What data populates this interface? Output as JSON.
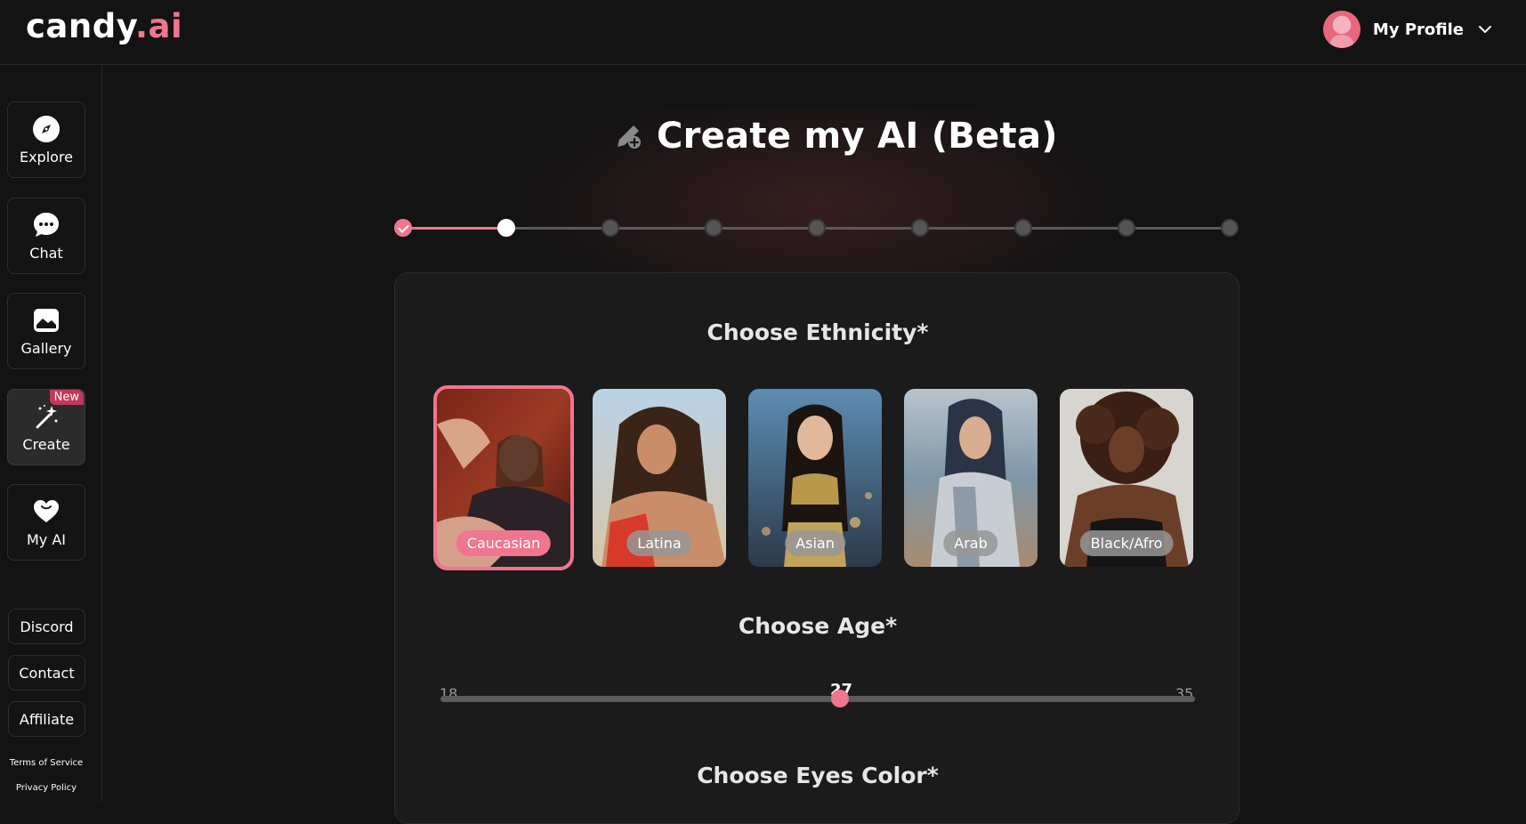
{
  "app": {
    "logo_main": "candy",
    "logo_suffix": ".ai",
    "accent": "#f0758e"
  },
  "header": {
    "profile_label": "My Profile",
    "profile_icon": "avatar",
    "dropdown_icon": "chevron-down-icon"
  },
  "sidebar": {
    "items": [
      {
        "label": "Explore",
        "icon": "compass-icon"
      },
      {
        "label": "Chat",
        "icon": "chat-bubble-icon"
      },
      {
        "label": "Gallery",
        "icon": "image-icon"
      },
      {
        "label": "Create",
        "icon": "magic-wand-icon",
        "badge": "New",
        "active": true
      },
      {
        "label": "My AI",
        "icon": "heart-icon"
      }
    ],
    "links": [
      "Discord",
      "Contact",
      "Affiliate"
    ],
    "legal": [
      "Terms of Service",
      "Privacy Policy"
    ]
  },
  "main": {
    "title": "Create my AI (Beta)",
    "title_icon": "pencil-plus-icon",
    "stepper": {
      "total_steps": 9,
      "completed": 1,
      "current": 2
    },
    "ethnicity": {
      "title": "Choose Ethnicity*",
      "options": [
        "Caucasian",
        "Latina",
        "Asian",
        "Arab",
        "Black/Afro"
      ],
      "selected": "Caucasian"
    },
    "age": {
      "title": "Choose Age*",
      "min": "18",
      "max": "35",
      "value": "27"
    },
    "eyes": {
      "title": "Choose Eyes Color*"
    }
  }
}
